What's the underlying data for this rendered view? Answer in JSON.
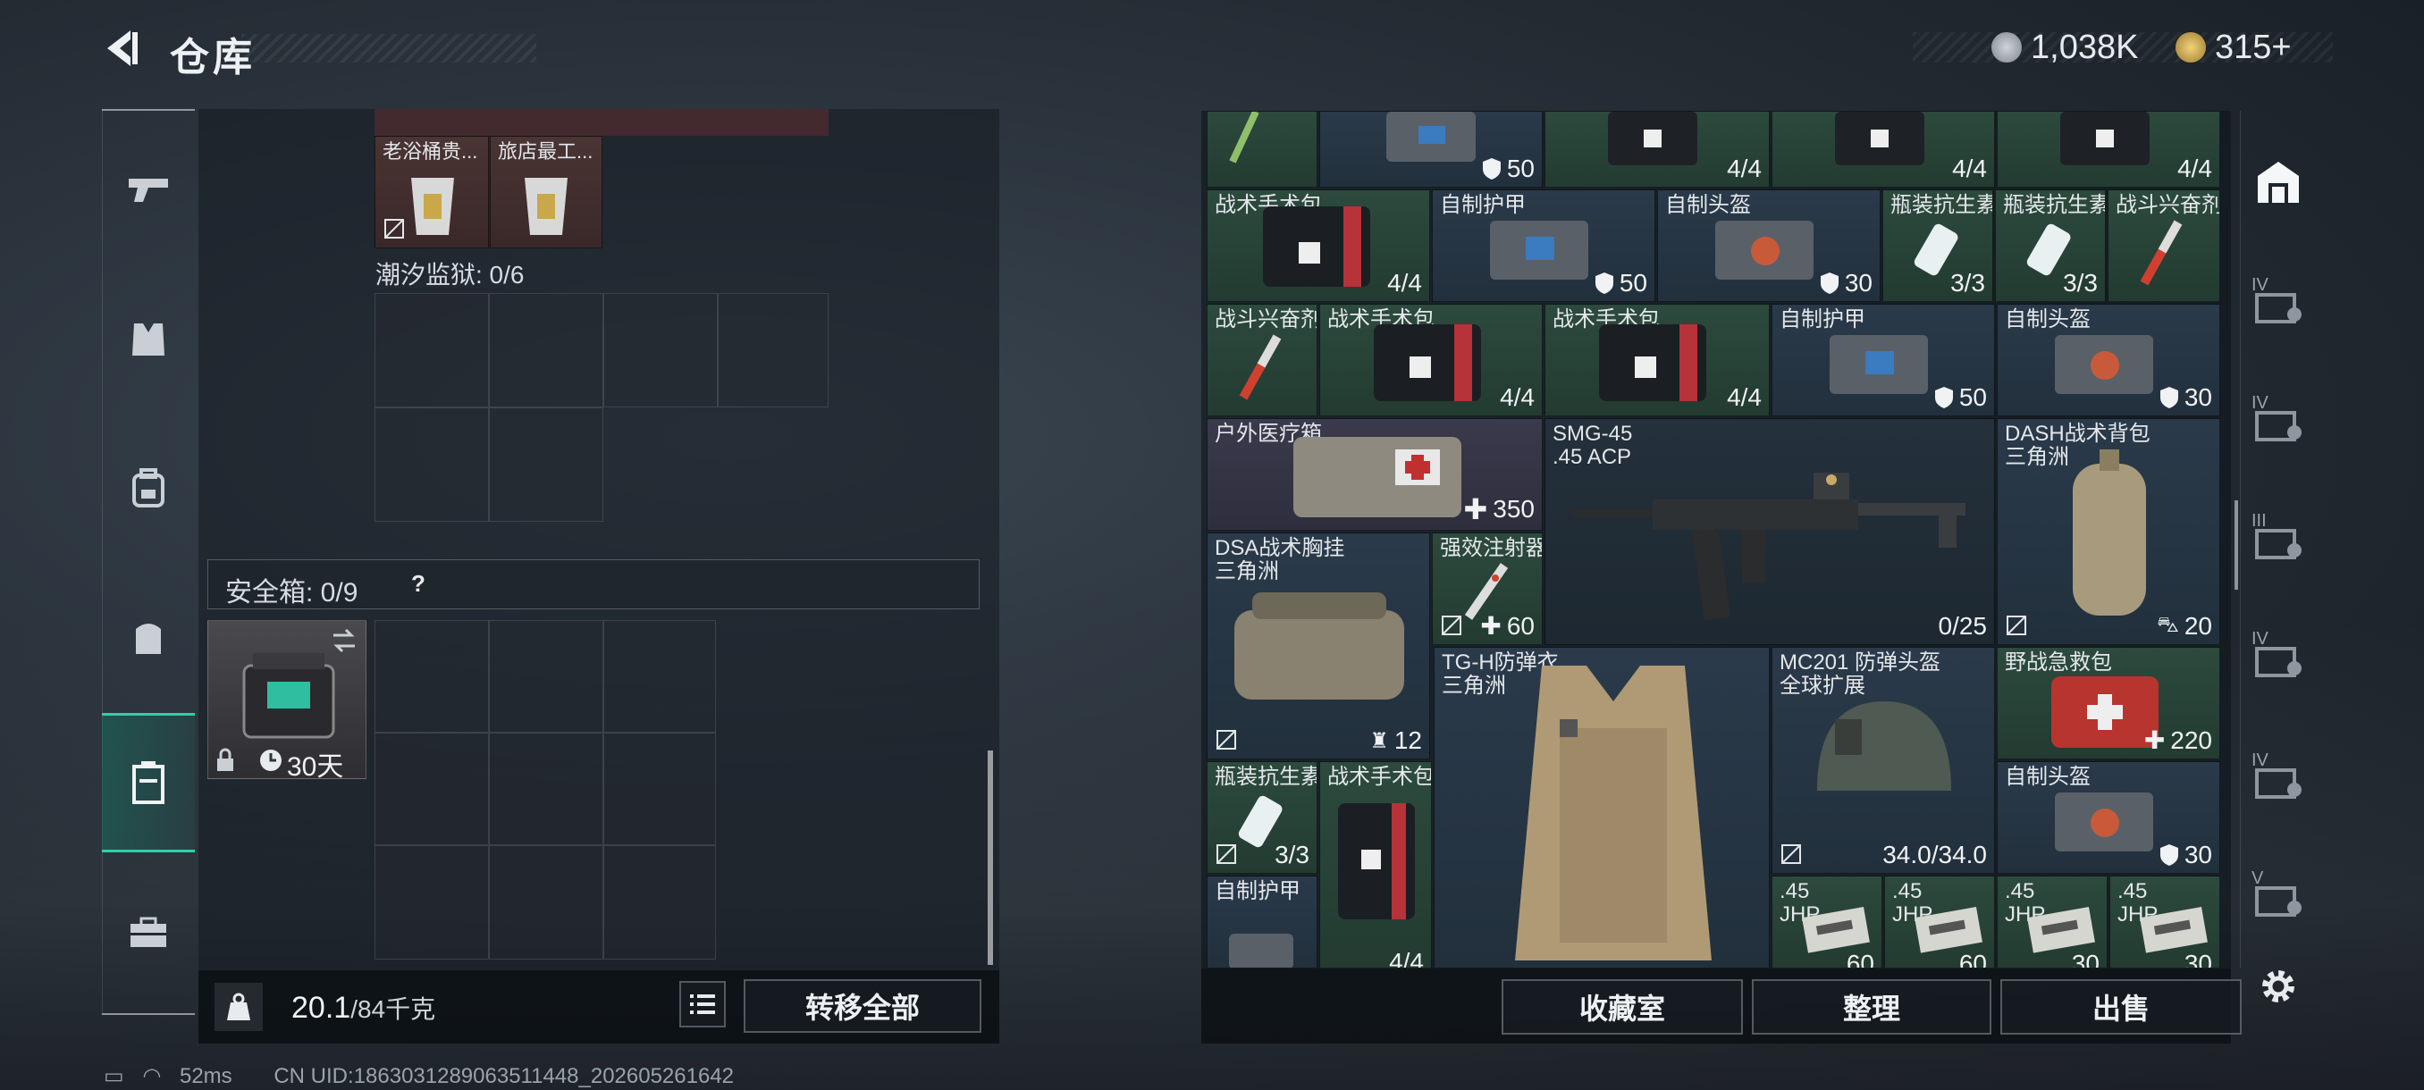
{
  "header": {
    "title": "仓库",
    "coins": "1,038K",
    "tickets": "315+"
  },
  "nav": {
    "items": [
      "weapons",
      "armor",
      "backpack",
      "chest-rig",
      "safe-box",
      "toolbox"
    ],
    "active": "safe-box"
  },
  "left_panel": {
    "top_items": [
      {
        "name": "老浴桶贵..."
      },
      {
        "name": "旅店最工..."
      }
    ],
    "prison_label": "潮汐监狱: 0/6",
    "safe_label": "安全箱: 0/9",
    "help": "?",
    "safe_box_timer": "30天",
    "weight": {
      "current": "20.1",
      "max": "/84千克"
    },
    "transfer_all": "转移全部"
  },
  "items": [
    {
      "name": "",
      "value": "50",
      "icon": "shield"
    },
    {
      "name": "",
      "value": "4/4"
    },
    {
      "name": "",
      "value": "4/4"
    },
    {
      "name": "",
      "value": "4/4"
    },
    {
      "name": "战术手术包",
      "value": "4/4"
    },
    {
      "name": "自制护甲",
      "value": "50",
      "icon": "shield"
    },
    {
      "name": "自制头盔",
      "value": "30",
      "icon": "shield"
    },
    {
      "name": "瓶装抗生素",
      "value": "3/3"
    },
    {
      "name": "瓶装抗生素",
      "value": "3/3"
    },
    {
      "name": "战斗兴奋剂",
      "value": ""
    },
    {
      "name": "战斗兴奋剂",
      "value": ""
    },
    {
      "name": "战术手术包",
      "value": "4/4"
    },
    {
      "name": "战术手术包",
      "value": "4/4"
    },
    {
      "name": "自制护甲",
      "value": "50",
      "icon": "shield"
    },
    {
      "name": "自制头盔",
      "value": "30",
      "icon": "shield"
    },
    {
      "name": "户外医疗箱",
      "value": "350",
      "icon": "plus"
    },
    {
      "name": "SMG-45\n.45 ACP",
      "value": "0/25"
    },
    {
      "name": "DASH战术背包\n三角洲",
      "value": "20",
      "icon": "bag"
    },
    {
      "name": "DSA战术胸挂\n三角洲",
      "value": "12",
      "icon": "rig"
    },
    {
      "name": "强效注射器",
      "value": "60",
      "icon": "plus"
    },
    {
      "name": "TG-H防弹衣\n三角洲",
      "value": ""
    },
    {
      "name": "MC201 防弹头盔\n全球扩展",
      "value": "34.0/34.0"
    },
    {
      "name": "野战急救包",
      "value": "220",
      "icon": "plus"
    },
    {
      "name": "瓶装抗生素",
      "value": "3/3"
    },
    {
      "name": "战术手术包",
      "value": "4/4"
    },
    {
      "name": "自制头盔",
      "value": "30",
      "icon": "shield"
    },
    {
      "name": "自制护甲",
      "value": ""
    },
    {
      "name": ".45\nJHP",
      "value": "60"
    },
    {
      "name": ".45\nJHP",
      "value": "60"
    },
    {
      "name": ".45\nJHP",
      "value": "30"
    },
    {
      "name": ".45\nJHP",
      "value": "30"
    }
  ],
  "right_buttons": {
    "collection": "收藏室",
    "sort": "整理",
    "sell": "出售"
  },
  "right_sidebar": {
    "levels": [
      "IV",
      "IV",
      "III",
      "IV",
      "IV",
      "V"
    ]
  },
  "status": {
    "ping": "52ms",
    "uid": "CN UID:1863031289063511448_202605261642"
  },
  "colors": {
    "accent": "#2fd0a8",
    "rarity_green": "#2c4a3d",
    "rarity_blue": "#2a3a4a",
    "rarity_purple": "#3a3a4c",
    "rarity_red": "#4a3434"
  }
}
